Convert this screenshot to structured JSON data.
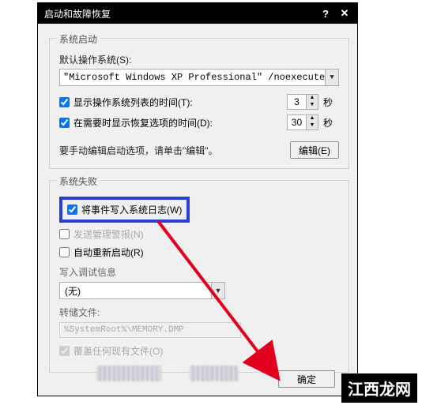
{
  "window": {
    "title": "启动和故障恢复",
    "help_label": "?",
    "close_label": "✕"
  },
  "startup": {
    "legend": "系统启动",
    "default_os_label": "默认操作系统(S):",
    "default_os_value": "\"Microsoft Windows XP Professional\" /noexecute=optin",
    "show_os_list": {
      "label": "显示操作系统列表的时间(T):",
      "checked": true,
      "seconds": "3",
      "unit": "秒"
    },
    "show_recovery": {
      "label": "在需要时显示恢复选项的时间(D):",
      "checked": true,
      "seconds": "30",
      "unit": "秒"
    },
    "edit_prompt": "要手动编辑启动选项，请单击\"编辑\"。",
    "edit_button": "编辑(E)"
  },
  "failure": {
    "legend": "系统失败",
    "write_log": {
      "label": "将事件写入系统日志(W)",
      "checked": true,
      "highlighted": true
    },
    "send_alert": {
      "label": "发送管理警报(N)",
      "checked": false
    },
    "auto_restart": {
      "label": "自动重新启动(R)",
      "checked": false
    },
    "debug_header": "写入调试信息",
    "debug_select": "(无)",
    "dump_header": "转储文件:",
    "dump_path": "%SystemRoot%\\MEMORY.DMP",
    "overwrite": {
      "label": "覆盖任何现有文件(O)",
      "checked": true
    }
  },
  "buttons": {
    "ok": "确定"
  },
  "watermark": "江西龙网"
}
